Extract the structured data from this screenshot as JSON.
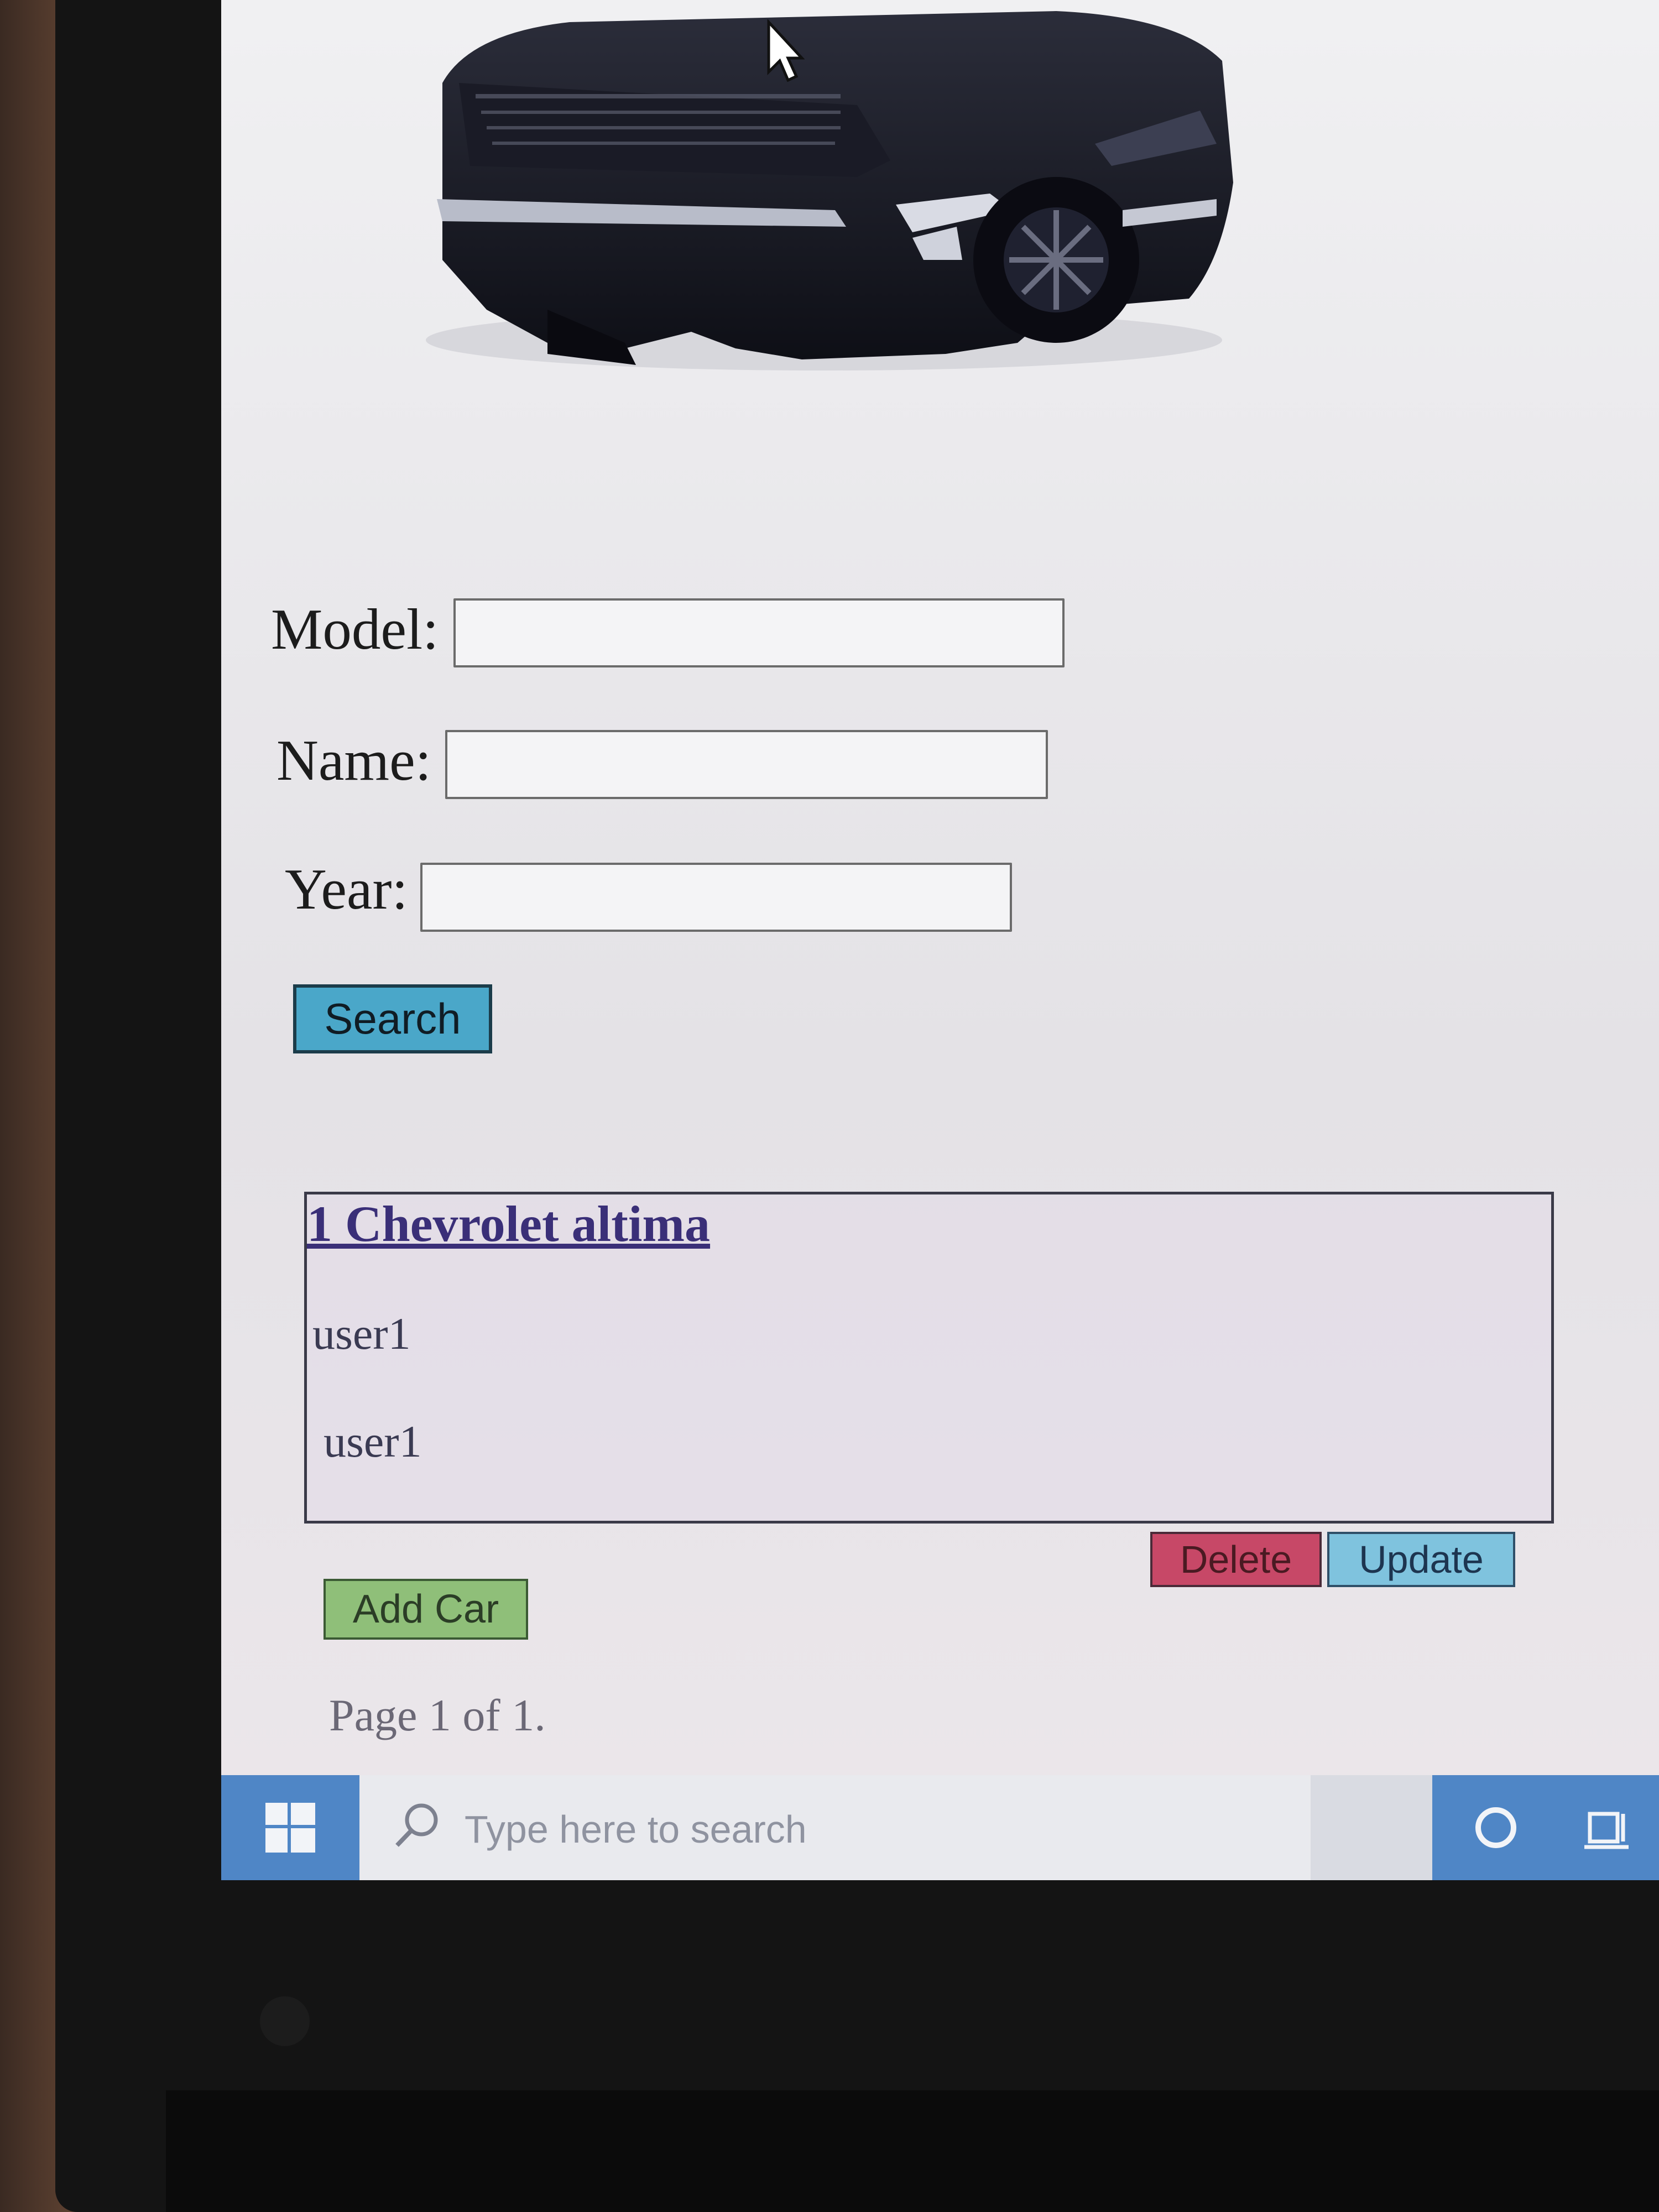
{
  "form": {
    "model_label": "Model:",
    "model_value": "",
    "name_label": "Name:",
    "name_value": "",
    "year_label": "Year:",
    "year_value": "",
    "search_button": "Search"
  },
  "results": {
    "items": [
      {
        "title": "1 Chevrolet altima",
        "lines": [
          "user1",
          "user1"
        ]
      }
    ],
    "delete_button": "Delete",
    "update_button": "Update"
  },
  "actions": {
    "add_car_button": "Add Car"
  },
  "pagination": {
    "text": "Page 1 of 1."
  },
  "taskbar": {
    "search_placeholder": "Type here to search",
    "start_icon": "windows-logo-icon",
    "search_icon": "magnifier-icon",
    "cortana_icon": "cortana-circle-icon",
    "task_view_icon": "task-view-icon"
  },
  "colors": {
    "search_button": "#4aa7c9",
    "delete_button": "#c74867",
    "update_button": "#7fc3de",
    "add_car_button": "#8fbf79",
    "taskbar_accent": "#4f86c6",
    "card_title": "#3a2f78"
  }
}
